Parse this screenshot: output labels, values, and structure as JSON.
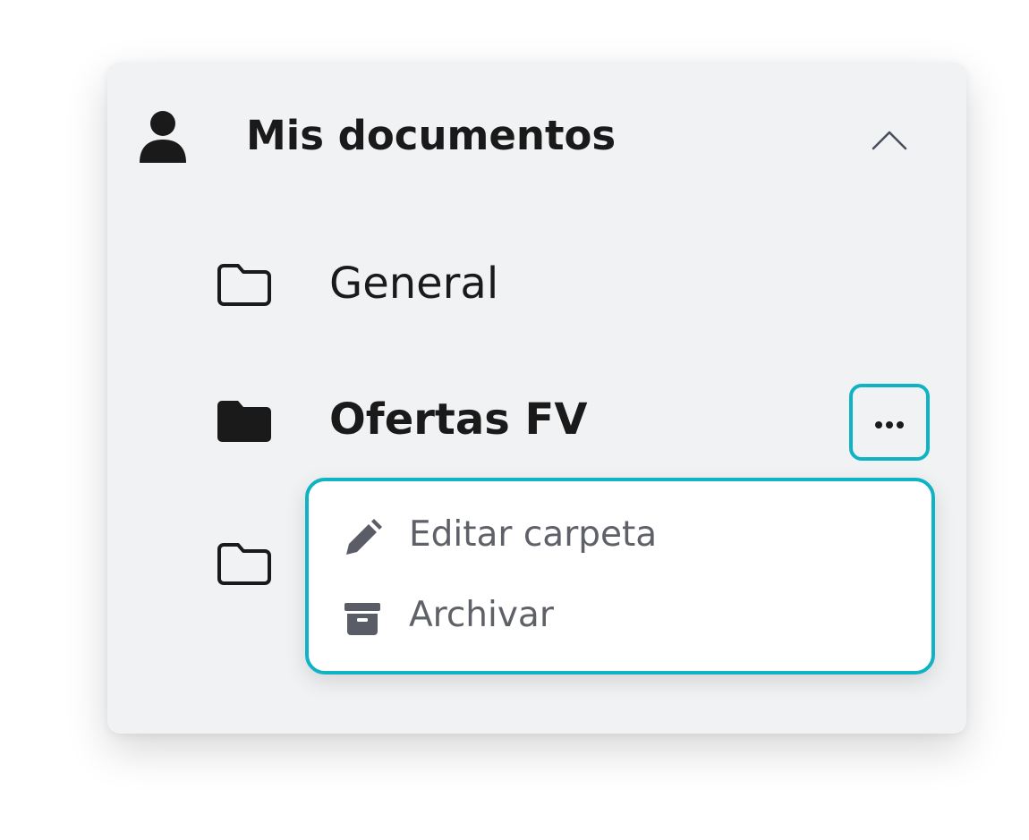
{
  "section": {
    "title": "Mis documentos",
    "user_icon": "user-icon",
    "collapse_icon": "chevron-up-icon"
  },
  "folders": [
    {
      "label": "General",
      "icon": "folder-outline-icon",
      "active": false
    },
    {
      "label": "Ofertas FV",
      "icon": "folder-filled-icon",
      "active": true
    },
    {
      "label": "",
      "icon": "folder-outline-icon",
      "active": false
    }
  ],
  "context_menu": {
    "trigger_icon": "more-horizontal-icon",
    "items": [
      {
        "label": "Editar carpeta",
        "icon": "pencil-icon"
      },
      {
        "label": "Archivar",
        "icon": "archive-icon"
      }
    ]
  },
  "colors": {
    "accent": "#10b3c4",
    "panel_bg": "#f1f2f4",
    "text_dark": "#1a1a1a",
    "text_muted": "#5f6168"
  }
}
